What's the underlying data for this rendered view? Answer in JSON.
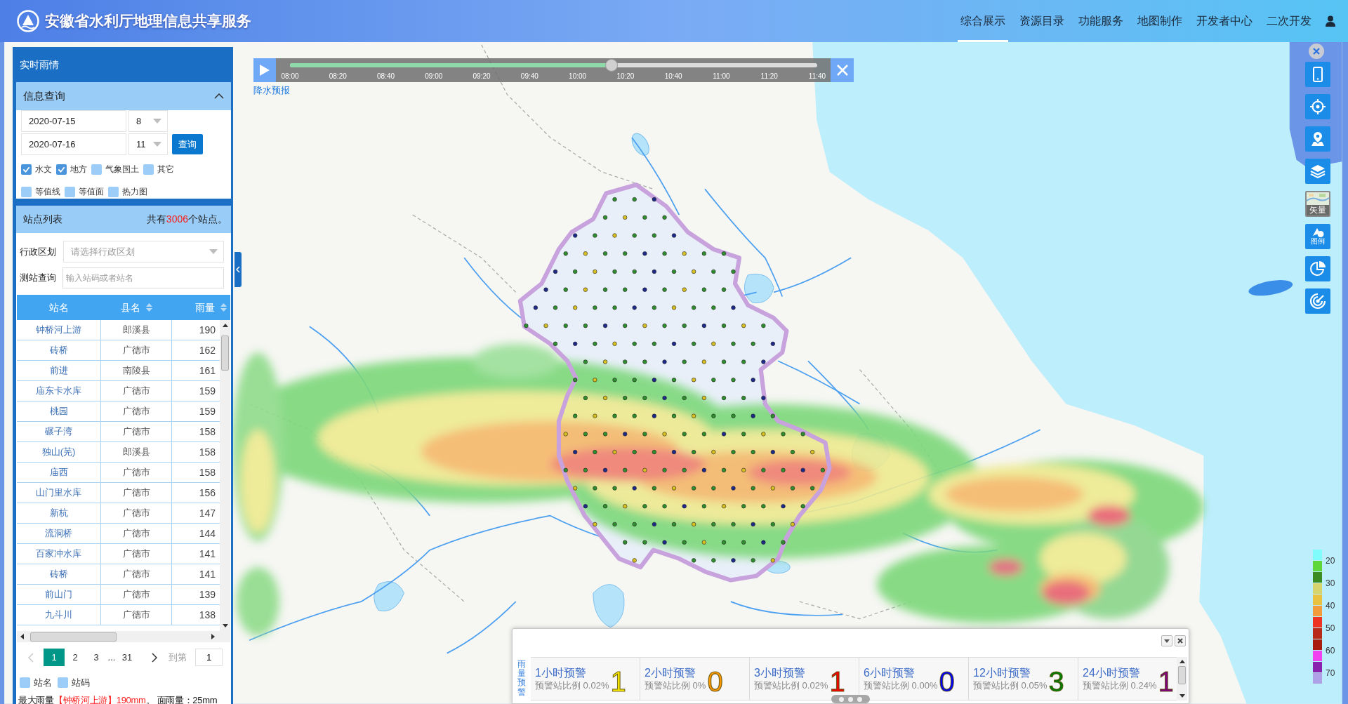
{
  "header": {
    "title": "安徽省水利厅地理信息共享服务",
    "nav": [
      {
        "label": "综合展示",
        "selected": true
      },
      {
        "label": "资源目录",
        "selected": false
      },
      {
        "label": "功能服务",
        "selected": false
      },
      {
        "label": "地图制作",
        "selected": false
      },
      {
        "label": "开发者中心",
        "selected": false
      },
      {
        "label": "二次开发",
        "selected": false
      }
    ]
  },
  "left_panel": {
    "title": "实时雨情",
    "query": {
      "title": "信息查询",
      "expanded": true,
      "start_date": "2020-07-15",
      "start_hour": "8",
      "end_date": "2020-07-16",
      "end_hour": "11",
      "button": "查询",
      "layers": [
        {
          "label": "水文",
          "checked": true
        },
        {
          "label": "地方",
          "checked": true
        },
        {
          "label": "气象国土",
          "checked": false
        },
        {
          "label": "其它",
          "checked": false
        }
      ],
      "overlays": [
        {
          "label": "等值线",
          "checked": false
        },
        {
          "label": "等值面",
          "checked": false
        },
        {
          "label": "热力图",
          "checked": false
        }
      ]
    },
    "stations": {
      "title": "站点列表",
      "count": {
        "prefix": "共有",
        "value": "3006",
        "suffix": "个站点。"
      },
      "region": {
        "label": "行政区划",
        "placeholder": "请选择行政区划"
      },
      "search": {
        "label": "测站查询",
        "placeholder": "输入站码或者站名"
      },
      "columns": [
        {
          "label": "站名",
          "sortable": false
        },
        {
          "label": "县名",
          "sortable": true
        },
        {
          "label": "雨量",
          "sortable": true
        }
      ],
      "rows": [
        {
          "station": "钟桥河上游",
          "county": "郎溪县",
          "rainfall": "190"
        },
        {
          "station": "砖桥",
          "county": "广德市",
          "rainfall": "162"
        },
        {
          "station": "前进",
          "county": "南陵县",
          "rainfall": "161"
        },
        {
          "station": "庙东卡水库",
          "county": "广德市",
          "rainfall": "159"
        },
        {
          "station": "桃园",
          "county": "广德市",
          "rainfall": "159"
        },
        {
          "station": "碾子湾",
          "county": "广德市",
          "rainfall": "158"
        },
        {
          "station": "独山(芜)",
          "county": "郎溪县",
          "rainfall": "158"
        },
        {
          "station": "庙西",
          "county": "广德市",
          "rainfall": "158"
        },
        {
          "station": "山门里水库",
          "county": "广德市",
          "rainfall": "156"
        },
        {
          "station": "新杭",
          "county": "广德市",
          "rainfall": "147"
        },
        {
          "station": "流洞桥",
          "county": "广德市",
          "rainfall": "144"
        },
        {
          "station": "百家冲水库",
          "county": "广德市",
          "rainfall": "141"
        },
        {
          "station": "砖桥",
          "county": "广德市",
          "rainfall": "141"
        },
        {
          "station": "前山门",
          "county": "广德市",
          "rainfall": "139"
        },
        {
          "station": "九斗川",
          "county": "广德市",
          "rainfall": "138"
        }
      ],
      "pagination": {
        "prev": {
          "disabled": true
        },
        "pages": [
          {
            "label": "1",
            "selected": true
          },
          {
            "label": "2",
            "selected": false
          },
          {
            "label": "3",
            "selected": false
          }
        ],
        "ellipsis": "...",
        "last_page": {
          "label": "31",
          "selected": false
        },
        "next": {
          "disabled": false
        },
        "goto_label": "到第",
        "goto_value": "1"
      },
      "label_options": [
        {
          "label": "站名",
          "checked": false
        },
        {
          "label": "站码",
          "checked": false
        }
      ],
      "summary": {
        "label": "最大雨量",
        "highlight": "【钟桥河上游】190mm",
        "rest": "。 面雨量：25mm"
      }
    }
  },
  "timeline": {
    "playing": false,
    "ticks": [
      "08:00",
      "08:20",
      "08:40",
      "09:00",
      "09:20",
      "09:40",
      "10:00",
      "10:20",
      "10:40",
      "11:00",
      "11:20",
      "11:40"
    ],
    "level": 0.61,
    "link": "降水预报"
  },
  "toolbar": {
    "basemap_label": "矢量",
    "legend_label": "图例"
  },
  "rain_legend": {
    "swatches": [
      {
        "color": "#80fcfc"
      },
      {
        "color": "#5fd63a"
      },
      {
        "color": "#3b8c22"
      },
      {
        "color": "#d6d46c"
      },
      {
        "color": "#e8c240"
      },
      {
        "color": "#f39c3c"
      },
      {
        "color": "#ee3322"
      },
      {
        "color": "#b82a1a"
      },
      {
        "color": "#a81c10"
      },
      {
        "color": "#f040f0"
      },
      {
        "color": "#8a22b0"
      },
      {
        "color": "#b0a0e8"
      }
    ],
    "labels": [
      "20",
      "30",
      "40",
      "50",
      "60",
      "70"
    ]
  },
  "warning_panel": {
    "title": "雨量预警",
    "cards": [
      {
        "title": "1小时预警",
        "ratio": "预警站比例 0.02%",
        "count": "1",
        "color": "#ffee00"
      },
      {
        "title": "2小时预警",
        "ratio": "预警站比例 0%",
        "count": "0",
        "color": "#ff9900"
      },
      {
        "title": "3小时预警",
        "ratio": "预警站比例 0.02%",
        "count": "1",
        "color": "#ff0000"
      },
      {
        "title": "6小时预警",
        "ratio": "预警站比例 0.00%",
        "count": "0",
        "color": "#0000ff"
      },
      {
        "title": "12小时预警",
        "ratio": "预警站比例 0.05%",
        "count": "3",
        "color": "#008000"
      },
      {
        "title": "24小时预警",
        "ratio": "预警站比例 0.24%",
        "count": "1",
        "color": "#800080"
      }
    ]
  }
}
